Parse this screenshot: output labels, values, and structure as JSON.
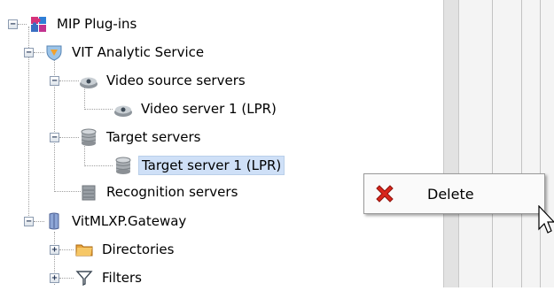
{
  "tree": {
    "items": [
      {
        "label": "MIP Plug-ins",
        "icon": "puzzle-icon",
        "expander": "−"
      },
      {
        "label": "VIT Analytic Service",
        "icon": "shield-icon",
        "expander": "−"
      },
      {
        "label": "Video source servers",
        "icon": "camera-icon",
        "expander": "−"
      },
      {
        "label": "Video server 1 (LPR)",
        "icon": "camera-icon",
        "expander": ""
      },
      {
        "label": "Target servers",
        "icon": "database-icon",
        "expander": "−"
      },
      {
        "label": "Target server 1 (LPR)",
        "icon": "database-icon",
        "expander": "",
        "selected": true
      },
      {
        "label": "Recognition servers",
        "icon": "server-icon",
        "expander": ""
      },
      {
        "label": "VitMLXP.Gateway",
        "icon": "device-icon",
        "expander": "−"
      },
      {
        "label": "Directories",
        "icon": "folder-icon",
        "expander": "+"
      },
      {
        "label": "Filters",
        "icon": "filter-icon",
        "expander": "+"
      }
    ]
  },
  "context_menu": {
    "items": [
      {
        "label": "Delete",
        "icon": "delete-x-icon"
      }
    ]
  },
  "colors": {
    "selection": "#cfe0f7",
    "delete_icon": "#d9261c"
  }
}
